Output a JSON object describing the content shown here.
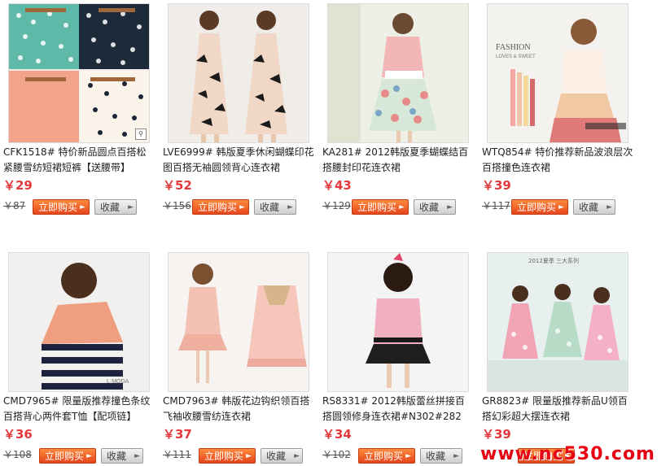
{
  "products": [
    {
      "title": "CFK1518# 特价新品圆点百搭松紧腰雪纺短裙短裤【送腰带】",
      "price": "￥29",
      "original": "￥87",
      "buy_label": "立即购买",
      "fav_label": "收藏",
      "image": "skirts-polka-dot-photo"
    },
    {
      "title": "LVE6999# 韩版夏季休闲蝴蝶印花图百搭无袖圆领背心连衣裙",
      "price": "￥52",
      "original": "￥156",
      "buy_label": "立即购买",
      "fav_label": "收藏",
      "image": "butterfly-print-dress-photo"
    },
    {
      "title": "KA281# 2012韩版夏季蝴蝶结百搭腰封印花连衣裙",
      "price": "￥43",
      "original": "￥129",
      "buy_label": "立即购买",
      "fav_label": "收藏",
      "image": "floral-bow-dress-photo"
    },
    {
      "title": "WTQ854# 特价推荐新品波浪层次百搭撞色连衣裙",
      "price": "￥39",
      "original": "￥117",
      "buy_label": "立即购买",
      "fav_label": "收藏",
      "image": "layered-dress-photo"
    },
    {
      "title": "CMD7965# 限量版推荐撞色条纹百搭背心两件套T恤【配项链】",
      "price": "￥36",
      "original": "￥108",
      "buy_label": "立即购买",
      "fav_label": "收藏",
      "image": "striped-top-photo"
    },
    {
      "title": "CMD7963# 韩版花边钩织领百搭飞袖收腰雪纺连衣裙",
      "price": "￥37",
      "original": "￥111",
      "buy_label": "立即购买",
      "fav_label": "收藏",
      "image": "pink-chiffon-dress-photo"
    },
    {
      "title": "RS8331# 2012韩版蕾丝拼接百搭圆领修身连衣裙#N302#282",
      "price": "￥34",
      "original": "￥102",
      "buy_label": "立即购买",
      "fav_label": "收藏",
      "image": "pink-lace-dress-photo"
    },
    {
      "title": "GR8823# 限量版推荐新品U领百搭幻彩超大摆连衣裙",
      "price": "￥39",
      "original": "",
      "buy_label": "立即购买",
      "fav_label": "收藏",
      "image": "floral-swing-dress-photo"
    }
  ],
  "thumb_text": {
    "p4_fashion": "FASHION",
    "p4_sub": "LOVES & SWEET",
    "p8_banner": "2012夏季 三大系列",
    "p5_brand": "L·MODA"
  },
  "zoom_icon": "magnifier-icon",
  "watermark": "www.nc530.com",
  "colors": {
    "price": "#e4393c",
    "buy": "#f0602a",
    "watermark": "#e60012"
  }
}
